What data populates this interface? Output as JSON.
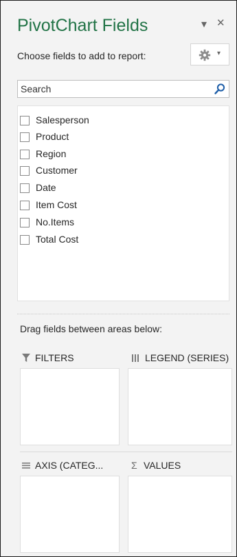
{
  "pane": {
    "title": "PivotChart Fields",
    "menu_glyph": "▾",
    "close_glyph": "✕",
    "choose_label": "Choose fields to add to report:",
    "tools_caret": "▾"
  },
  "search": {
    "placeholder": "Search"
  },
  "fields": [
    {
      "label": "Salesperson",
      "checked": false
    },
    {
      "label": "Product",
      "checked": false
    },
    {
      "label": "Region",
      "checked": false
    },
    {
      "label": "Customer",
      "checked": false
    },
    {
      "label": "Date",
      "checked": false
    },
    {
      "label": "Item Cost",
      "checked": false
    },
    {
      "label": "No.Items",
      "checked": false
    },
    {
      "label": "Total Cost",
      "checked": false
    }
  ],
  "drag_label": "Drag fields between areas below:",
  "areas": {
    "filters": {
      "label": "FILTERS",
      "icon": "filter-icon"
    },
    "legend": {
      "label": "LEGEND (SERIES)",
      "icon": "legend-bars-icon"
    },
    "axis": {
      "label": "AXIS (CATEG...",
      "icon": "axis-lines-icon"
    },
    "values": {
      "label": "VALUES",
      "icon": "sigma-icon",
      "glyph": "Σ"
    }
  },
  "colors": {
    "title_green": "#217346",
    "pane_bg": "#f3f3f3",
    "box_border": "#dedede"
  }
}
